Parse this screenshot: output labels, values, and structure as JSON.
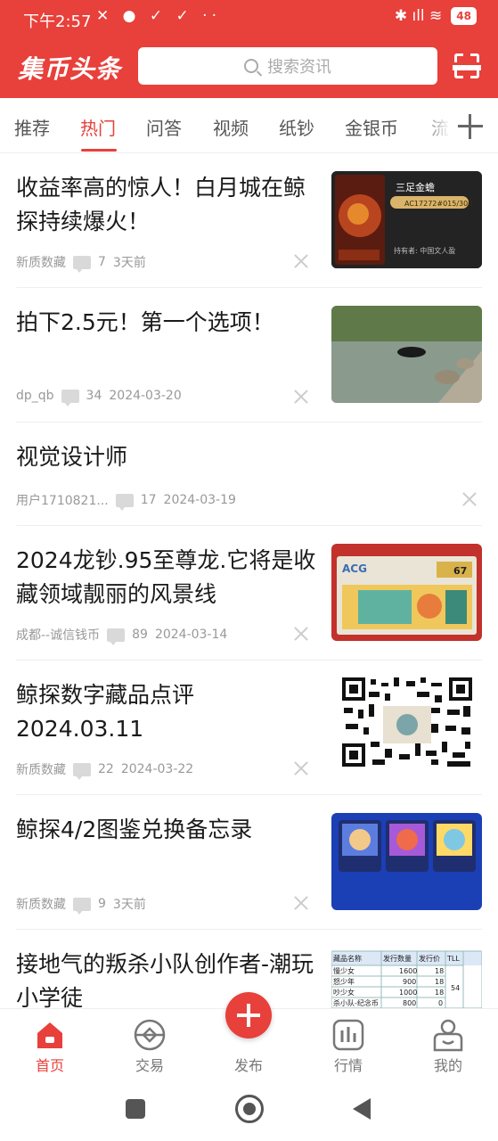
{
  "status_bar": {
    "time": "下午2:57",
    "left_icons": "✕ ● ✓ ✓ ··",
    "right_icons": "✱ ıll ≋",
    "battery": "48"
  },
  "header": {
    "logo": "集币头条",
    "search_placeholder": "搜索资讯",
    "scan_icon": "scan-icon"
  },
  "tabs": [
    "推荐",
    "热门",
    "问答",
    "视频",
    "纸钞",
    "金银币",
    "流"
  ],
  "active_tab": "热门",
  "articles": [
    {
      "title": "收益率高的惊人！白月城在鲸探持续爆火！",
      "author": "新质数藏",
      "comments": "7",
      "time": "3天前",
      "has_thumb": true,
      "thumb_text": "三足金蟾",
      "thumb_sub": "AC17272#015/300",
      "thumb_owner": "持有者:  中国文人盈"
    },
    {
      "title": "拍下2.5元！第一个选项！",
      "author": "dp_qb",
      "comments": "34",
      "time": "2024-03-20",
      "has_thumb": true
    },
    {
      "title": "视觉设计师",
      "author": "用户1710821...",
      "comments": "17",
      "time": "2024-03-19",
      "has_thumb": false
    },
    {
      "title": "2024龙钞.95至尊龙.它将是收藏领域靓丽的风景线",
      "author": "成都--诚信钱币",
      "comments": "89",
      "time": "2024-03-14",
      "has_thumb": true,
      "thumb_text": "ACG",
      "thumb_grade": "67"
    },
    {
      "title": "鲸探数字藏品点评 2024.03.11",
      "author": "新质数藏",
      "comments": "22",
      "time": "2024-03-22",
      "has_thumb": true
    },
    {
      "title": "鲸探4/2图鉴兑换备忘录",
      "author": "新质数藏",
      "comments": "9",
      "time": "3天前",
      "has_thumb": true
    },
    {
      "title": "接地气的叛杀小队创作者-潮玩小学徒",
      "has_thumb": true,
      "table_headers": [
        "藏品名称",
        "发行数量",
        "发行价",
        "TLL"
      ],
      "table_rows": [
        [
          "慢少女",
          "1600",
          "18"
        ],
        [
          "怒少年",
          "900",
          "18"
        ],
        [
          "吵少女",
          "1000",
          "18"
        ],
        [
          "杀小队-纪念币",
          "800",
          "0"
        ]
      ],
      "table_value": "54"
    }
  ],
  "bottom_nav": [
    {
      "label": "首页",
      "icon": "home-icon"
    },
    {
      "label": "交易",
      "icon": "trade-icon"
    },
    {
      "label": "发布",
      "icon": "publish-icon"
    },
    {
      "label": "行情",
      "icon": "market-icon"
    },
    {
      "label": "我的",
      "icon": "profile-icon"
    }
  ]
}
